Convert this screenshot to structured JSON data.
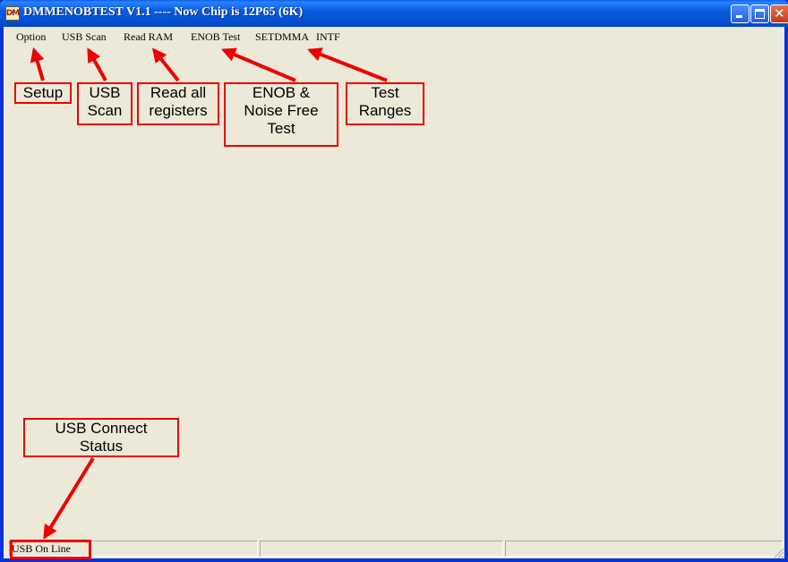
{
  "window": {
    "title": "DMMENOBTEST V1.1 ---- Now Chip is 12P65  (6K)",
    "icon": "app-icon"
  },
  "menu": [
    {
      "label": "Option"
    },
    {
      "label": "USB Scan"
    },
    {
      "label": "Read RAM"
    },
    {
      "label": "ENOB Test"
    },
    {
      "label": "SETDMMA"
    },
    {
      "label": "INTF"
    }
  ],
  "status": {
    "connection": "USB On Line",
    "pane2": "",
    "pane3": ""
  },
  "annotations": {
    "setup": "Setup",
    "usb_scan": [
      "USB",
      "Scan"
    ],
    "read_all": [
      "Read all",
      "registers"
    ],
    "enob": [
      "ENOB &",
      "Noise Free",
      "Test"
    ],
    "test_ranges": [
      "Test",
      "Ranges"
    ],
    "usb_connect": [
      "USB Connect",
      "Status"
    ]
  },
  "colors": {
    "annotation": "#ee0000",
    "window_bg": "#ece9d8",
    "titlebar": "#0653d6"
  }
}
